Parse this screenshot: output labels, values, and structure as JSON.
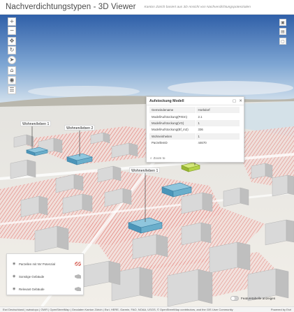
{
  "header": {
    "title": "Nachverdichtungstypen - 3D Viewer",
    "subtitle": "Kanton Zürich basiert aus 3D Ansicht von Nachverdichtungspotenzialen"
  },
  "toolbar": {
    "zoom_in": "+",
    "zoom_out": "−",
    "pan": "✥",
    "rotate": "↻",
    "compass": "➤",
    "home": "⌂",
    "locate": "◉",
    "layers": "▤",
    "list": "☰"
  },
  "right_toolbar": {
    "save": "▣",
    "print": "▤",
    "info": "▢"
  },
  "map_labels": [
    {
      "text": "Wohnen/leben 1"
    },
    {
      "text": "Wohnen/leben 2"
    },
    {
      "text": "Wohnen/leben 1"
    }
  ],
  "popup": {
    "title": "Aufstockung Modell",
    "rows": [
      {
        "key": "Gemeindename",
        "value": "Horbdorf"
      },
      {
        "key": "ModellAufstockung(PrEm)",
        "value": "2.1"
      },
      {
        "key": "ModellAufstockung(VG)",
        "value": "1"
      },
      {
        "key": "ModellAufstockung(Bf_m2)",
        "value": "336"
      },
      {
        "key": "Wohneinheiten",
        "value": "1"
      },
      {
        "key": "ParzellenID",
        "value": "44670"
      }
    ],
    "zoom_label": "Zoom to",
    "colors": {
      "accent": "#333333"
    }
  },
  "legend": {
    "items": [
      {
        "label": "Parzellen mit NV Potenzial",
        "color": "#e4a9a2"
      },
      {
        "label": "Sonstige Gebäude",
        "color": "#b7b7b7"
      },
      {
        "label": "Relevant Gebäude",
        "color": "#b7b7b7"
      }
    ]
  },
  "toggle": {
    "label": "Featuretabelle anzeigen",
    "on": false
  },
  "attribution": {
    "left": "Esri Deutschland | swisstopo | GWR | OpenStreetMap | Geodaten Kanton Zürich | Esri, HERE, Garmin, FAO, NOAA, USGS, © OpenStreetMap contributors, and the GIS User Community",
    "right": "Powered by Esri"
  },
  "colors": {
    "highlight_blue": "#5aa8c7",
    "highlight_green": "#b5d34a",
    "parcel_red": "#d9544b",
    "building_grey": "#d2d2d2"
  }
}
